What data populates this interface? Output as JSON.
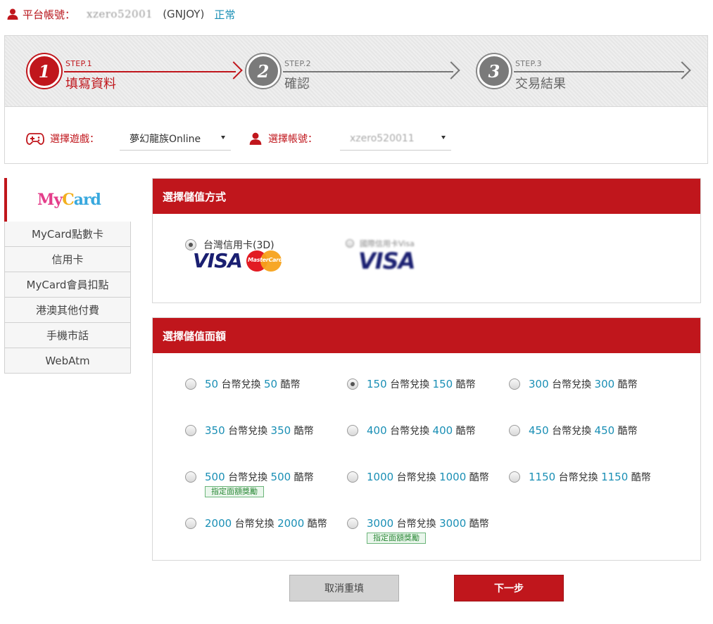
{
  "account": {
    "label": "平台帳號：",
    "value": "xzero52001",
    "org": "(GNJOY)",
    "status": "正常"
  },
  "steps": [
    {
      "num": "1",
      "small": "STEP.1",
      "title": "填寫資料",
      "state": "active"
    },
    {
      "num": "2",
      "small": "STEP.2",
      "title": "確認",
      "state": "inactive"
    },
    {
      "num": "3",
      "small": "STEP.3",
      "title": "交易結果",
      "state": "inactive"
    }
  ],
  "selectors": {
    "game": {
      "label": "選擇遊戲：",
      "value": "夢幻龍族Online"
    },
    "account": {
      "label": "選擇帳號：",
      "value": "xzero520011"
    }
  },
  "nav": {
    "logo": {
      "part1": "My",
      "part2": "C",
      "part3": "ard"
    },
    "items": [
      "MyCard點數卡",
      "信用卡",
      "MyCard會員扣點",
      "港澳其他付費",
      "手機市話",
      "WebAtm"
    ]
  },
  "payment": {
    "title": "選擇儲值方式",
    "option_label": "台灣信用卡(3D)",
    "visa_text": "VISA",
    "mastercard_text": "MasterCard",
    "visa2_text": "VISA",
    "visa2_caption": "國際信用卡Visa"
  },
  "amounts": {
    "title": "選擇儲值面額",
    "middle_text": "台幣兌換",
    "suffix": "酷幣",
    "badge": "指定面額獎勵",
    "options": [
      {
        "twd": "50",
        "coins": "50",
        "checked": false,
        "badge": false
      },
      {
        "twd": "150",
        "coins": "150",
        "checked": true,
        "badge": false
      },
      {
        "twd": "300",
        "coins": "300",
        "checked": false,
        "badge": false
      },
      {
        "twd": "350",
        "coins": "350",
        "checked": false,
        "badge": false
      },
      {
        "twd": "400",
        "coins": "400",
        "checked": false,
        "badge": false
      },
      {
        "twd": "450",
        "coins": "450",
        "checked": false,
        "badge": false
      },
      {
        "twd": "500",
        "coins": "500",
        "checked": false,
        "badge": true
      },
      {
        "twd": "1000",
        "coins": "1000",
        "checked": false,
        "badge": false
      },
      {
        "twd": "1150",
        "coins": "1150",
        "checked": false,
        "badge": false
      },
      {
        "twd": "2000",
        "coins": "2000",
        "checked": false,
        "badge": false
      },
      {
        "twd": "3000",
        "coins": "3000",
        "checked": false,
        "badge": true
      }
    ]
  },
  "buttons": {
    "reset": "取消重填",
    "next": "下一步"
  },
  "colors": {
    "brand_red": "#c0161c",
    "link_blue": "#1a8fb5"
  }
}
